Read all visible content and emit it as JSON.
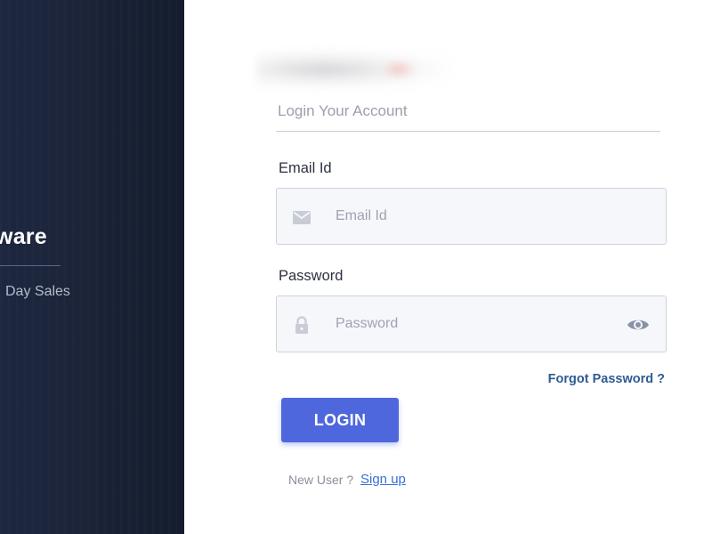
{
  "sidebar": {
    "title": "ftware",
    "subtitle": "Day Sales"
  },
  "login": {
    "heading": "Login Your Account",
    "email_label": "Email Id",
    "email_placeholder": "Email Id",
    "email_icon": "envelope-icon",
    "password_label": "Password",
    "password_placeholder": "Password",
    "password_icon": "lock-icon",
    "visibility_icon": "eye-icon",
    "forgot_label": "Forgot Password ?",
    "button_label": "LOGIN",
    "new_user_text": "New User ?",
    "signup_label": "Sign up"
  },
  "colors": {
    "accent": "#4f67dc",
    "link": "#2f5b91",
    "sidebar_bg": "#1b2438"
  }
}
